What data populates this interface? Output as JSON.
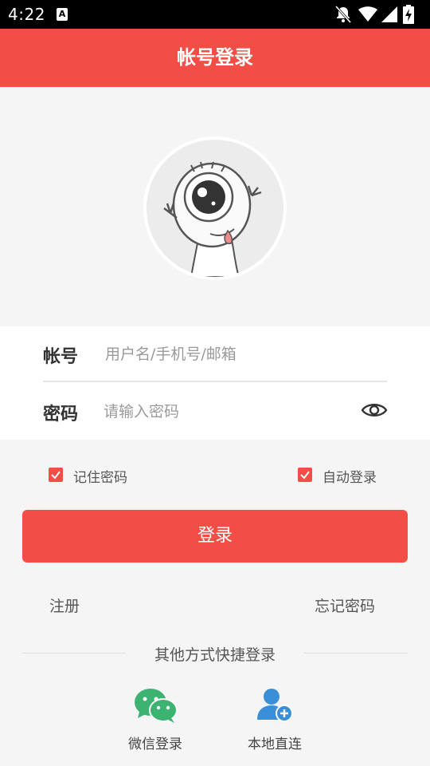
{
  "status_bar": {
    "time": "4:22",
    "notification_icon": "A",
    "icons": [
      "bell-off-icon",
      "wifi-icon",
      "signal-icon",
      "battery-charging-icon"
    ]
  },
  "header": {
    "title": "帐号登录"
  },
  "form": {
    "account": {
      "label": "帐号",
      "placeholder": "用户名/手机号/邮箱"
    },
    "password": {
      "label": "密码",
      "placeholder": "请输入密码"
    }
  },
  "options": {
    "remember_password": {
      "label": "记住密码",
      "checked": true
    },
    "auto_login": {
      "label": "自动登录",
      "checked": true
    }
  },
  "login_button": {
    "label": "登录"
  },
  "links": {
    "register": "注册",
    "forgot_password": "忘记密码"
  },
  "other_login": {
    "title": "其他方式快捷登录",
    "wechat": {
      "label": "微信登录",
      "icon": "wechat-icon"
    },
    "local": {
      "label": "本地直连",
      "icon": "add-user-icon"
    }
  },
  "colors": {
    "accent": "#f24e45",
    "wechat_green": "#3cb371",
    "local_blue": "#3b8ed8"
  }
}
